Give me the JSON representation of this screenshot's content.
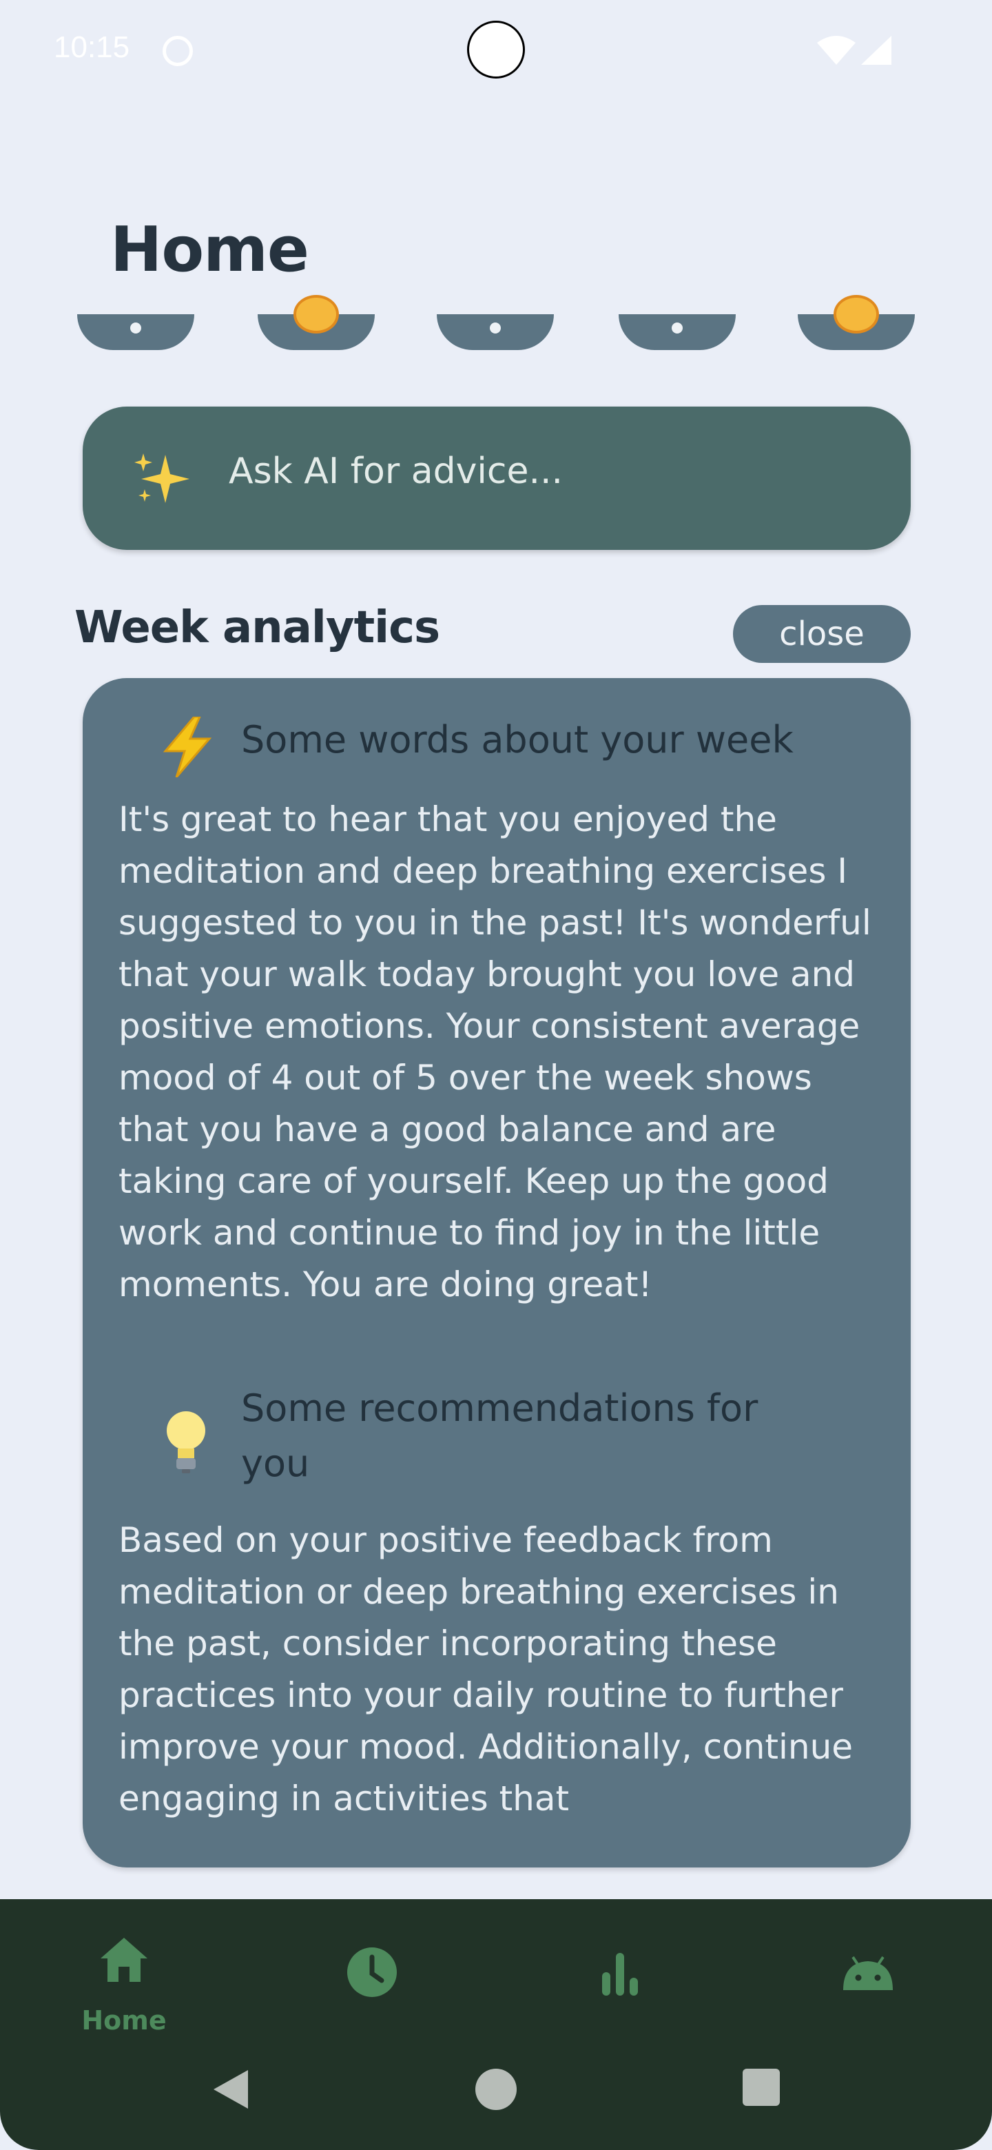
{
  "status_bar": {
    "time": "10:15"
  },
  "header": {
    "title": "Home"
  },
  "ask_ai": {
    "placeholder": "Ask AI for advice..."
  },
  "week_analytics": {
    "title": "Week analytics",
    "close_label": "close",
    "section1_title": "Some words about your week",
    "section1_text": "It's great to hear that you enjoyed the meditation and deep breathing exercises I suggested to you in the past! It's wonderful that your walk today brought you love and positive emotions. Your consistent average mood of 4 out of 5 over the week shows that you have a good balance and are taking care of yourself. Keep up the good work and continue to find joy in the little moments. You are doing great!",
    "section2_title": "Some recommendations for you",
    "section2_text": "Based on your positive feedback from meditation or deep breathing exercises in the past, consider incorporating these practices into your daily routine to further improve your mood. Additionally, continue engaging in activities that"
  },
  "bottom_nav": {
    "items": [
      {
        "label": "Home",
        "icon": "home-icon",
        "selected": true
      },
      {
        "label": "",
        "icon": "history-clock-icon"
      },
      {
        "label": "",
        "icon": "bar-chart-icon"
      },
      {
        "label": "",
        "icon": "android-icon"
      }
    ]
  },
  "colors": {
    "background": "#eaeef7",
    "card": "#5b7483",
    "ask_ai": "#4b6b6a",
    "nav_bar": "#213327",
    "nav_accent": "#4d8a5c"
  }
}
